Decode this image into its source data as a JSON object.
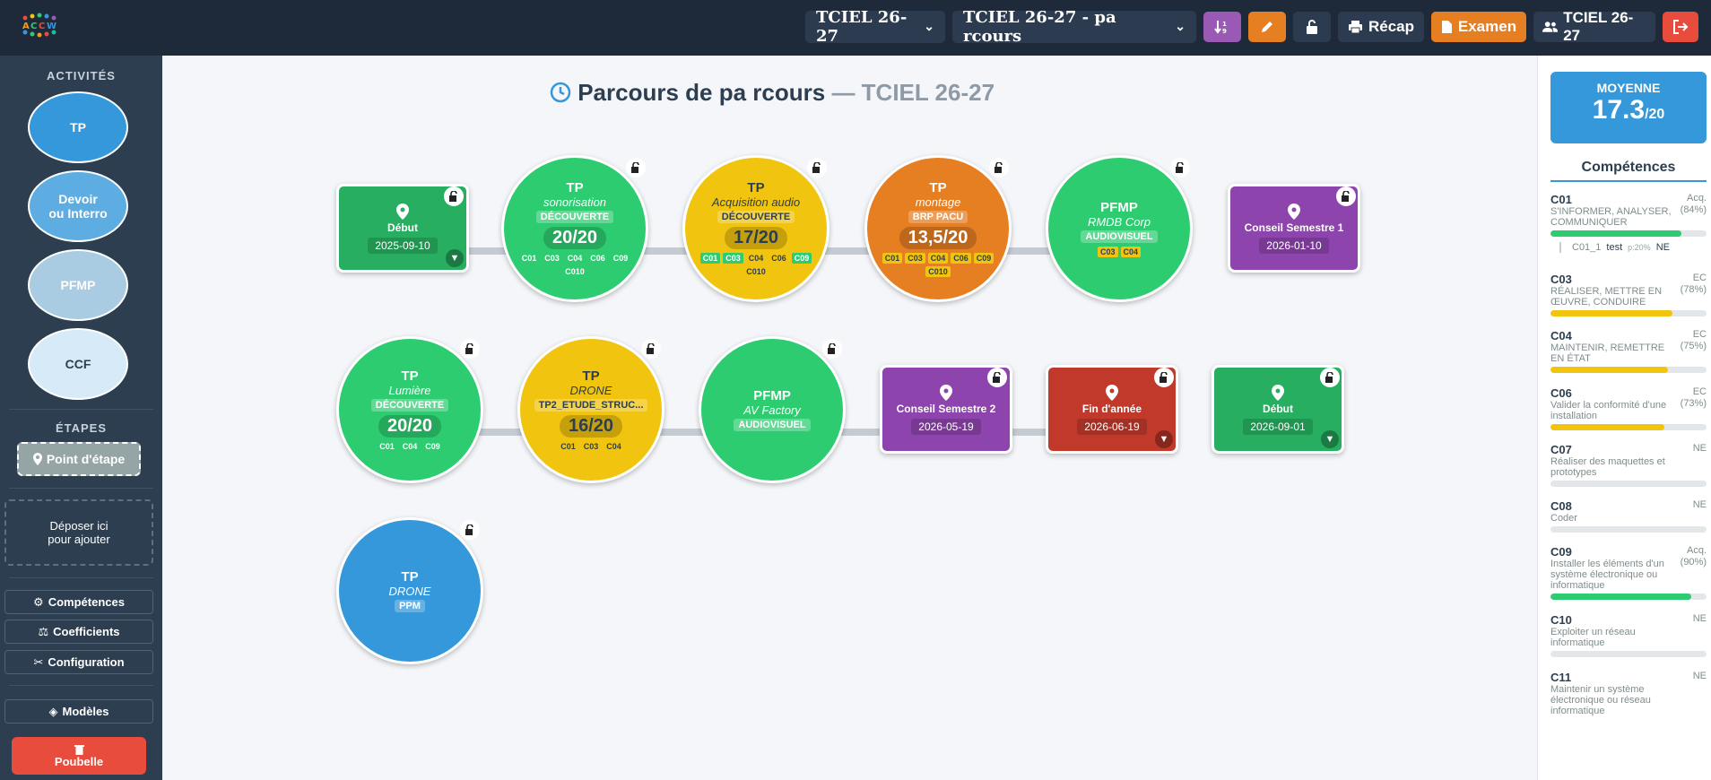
{
  "header": {
    "class_select": "TCIEL 26-27",
    "parcours_select": "TCIEL 26-27 - pa rcours",
    "recap_label": "Récap",
    "examen_label": "Examen",
    "group_label": "TCIEL 26-27"
  },
  "sidebar": {
    "activites_heading": "ACTIVITÉS",
    "activities": [
      "TP",
      "Devoir\nou Interro",
      "PFMP",
      "CCF"
    ],
    "etapes_heading": "ÉTAPES",
    "point_etape": "Point d'étape",
    "drop_zone": "Déposer ici pour ajouter",
    "competences": "Compétences",
    "coefficients": "Coefficients",
    "configuration": "Configuration",
    "modeles": "Modèles",
    "poubelle": "Poubelle"
  },
  "main": {
    "title": "Parcours de pa rcours",
    "dash": "—",
    "subtitle": "TCIEL 26-27"
  },
  "nodes": [
    {
      "type": "",
      "label": "Début",
      "date": "2025-09-10"
    },
    {
      "type": "TP",
      "sub": "sonorisation",
      "tag": "DÉCOUVERTE",
      "score": "20/20",
      "comps": [
        "C01",
        "C03",
        "C04",
        "C06",
        "C09",
        "C010"
      ]
    },
    {
      "type": "TP",
      "sub": "Acquisition audio",
      "tag": "DÉCOUVERTE",
      "score": "17/20",
      "comps": [
        "C01",
        "C03",
        "C04",
        "C06",
        "C09",
        "C010"
      ]
    },
    {
      "type": "TP",
      "sub": "montage",
      "tag": "BRP PACU",
      "score": "13,5/20",
      "comps": [
        "C01",
        "C03",
        "C04",
        "C06",
        "C09",
        "C010"
      ]
    },
    {
      "type": "PFMP",
      "sub": "RMDB Corp",
      "tag": "AUDIOVISUEL",
      "comps": [
        "C03",
        "C04"
      ]
    },
    {
      "type": "",
      "label": "Conseil Semestre 1",
      "date": "2026-01-10"
    },
    {
      "type": "TP",
      "sub": "Lumière",
      "tag": "DÉCOUVERTE",
      "score": "20/20",
      "comps": [
        "C01",
        "C04",
        "C09"
      ]
    },
    {
      "type": "TP",
      "sub": "DRONE",
      "tag": "TP2_ETUDE_STRUC...",
      "score": "16/20",
      "comps": [
        "C01",
        "C03",
        "C04"
      ]
    },
    {
      "type": "PFMP",
      "sub": "AV Factory",
      "tag": "AUDIOVISUEL"
    },
    {
      "type": "",
      "label": "Conseil Semestre 2",
      "date": "2026-05-19"
    },
    {
      "type": "",
      "label": "Fin d'année",
      "date": "2026-06-19"
    },
    {
      "type": "",
      "label": "Début",
      "date": "2026-09-01"
    },
    {
      "type": "TP",
      "sub": "DRONE",
      "tag": "PPM"
    }
  ],
  "right": {
    "moyenne_label": "MOYENNE",
    "moyenne_value": "17.3",
    "moyenne_max": "/20",
    "competences_heading": "Compétences",
    "items": [
      {
        "code": "C01",
        "desc": "S'INFORMER, ANALYSER, COMMUNIQUER",
        "status": "Acq.",
        "pct": "(84%)",
        "value": 84,
        "color": "#2ecc71"
      },
      {
        "code": "C03",
        "desc": "RÉALISER, METTRE EN ŒUVRE, CONDUIRE",
        "status": "EC",
        "pct": "(78%)",
        "value": 78,
        "color": "#f1c40f"
      },
      {
        "code": "C04",
        "desc": "MAINTENIR, REMETTRE EN ÉTAT",
        "status": "EC",
        "pct": "(75%)",
        "value": 75,
        "color": "#f1c40f"
      },
      {
        "code": "C06",
        "desc": "Valider la conformité d'une installation",
        "status": "EC",
        "pct": "(73%)",
        "value": 73,
        "color": "#f1c40f"
      },
      {
        "code": "C07",
        "desc": "Réaliser des maquettes et prototypes",
        "status": "NE",
        "pct": "",
        "value": 0,
        "color": "#e4e7ea"
      },
      {
        "code": "C08",
        "desc": "Coder",
        "status": "NE",
        "pct": "",
        "value": 0,
        "color": "#e4e7ea"
      },
      {
        "code": "C09",
        "desc": "Installer les éléments d'un système électronique ou informatique",
        "status": "Acq.",
        "pct": "(90%)",
        "value": 90,
        "color": "#2ecc71"
      },
      {
        "code": "C10",
        "desc": "Exploiter un réseau informatique",
        "status": "NE",
        "pct": "",
        "value": 0,
        "color": "#e4e7ea"
      },
      {
        "code": "C11",
        "desc": "Maintenir un système électronique ou réseau informatique",
        "status": "NE",
        "pct": "",
        "value": 0,
        "color": "#e4e7ea"
      }
    ],
    "sub_item": {
      "code": "C01_1",
      "label": "test",
      "weight": "p:20%",
      "status": "NE"
    }
  }
}
